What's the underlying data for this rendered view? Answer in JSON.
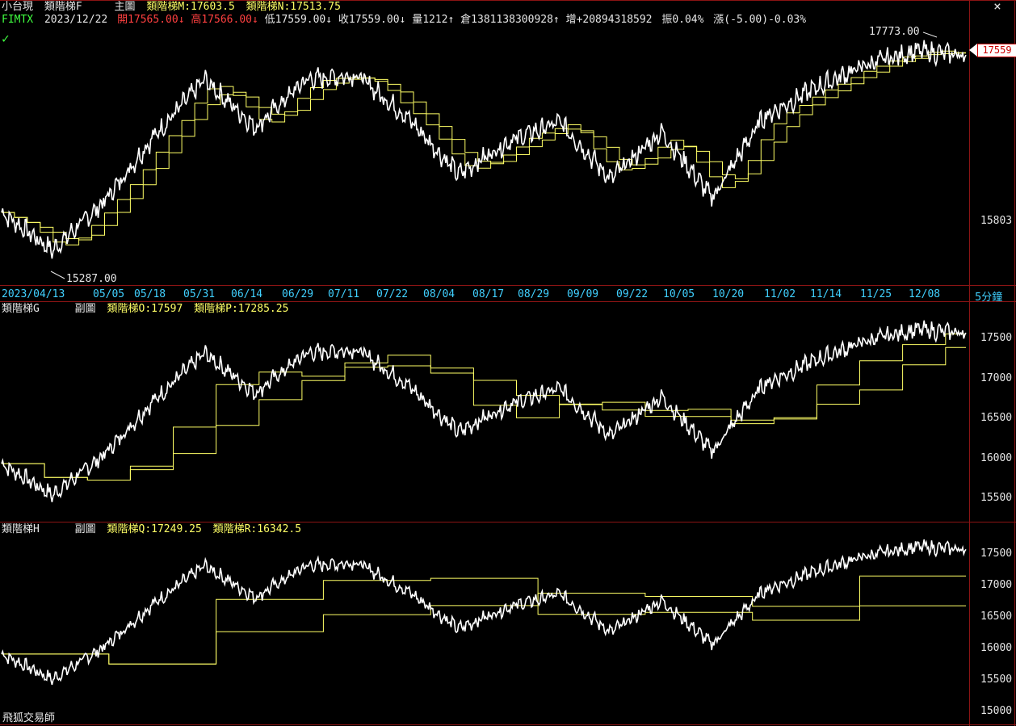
{
  "header": {
    "symbol": "小台現",
    "indicator": "類階梯F",
    "main_label": "主圖",
    "m_label": "類階梯M:",
    "m_value": "17603.5",
    "n_label": "類階梯N:",
    "n_value": "17513.75",
    "code": "FIMTX",
    "date": "2023/12/22",
    "open": "開17565.00↓",
    "high": "高17566.00↓",
    "low": "低17559.00↓",
    "close": "收17559.00↓",
    "volume": "量1212↑",
    "oi": "倉1381138300928↑",
    "incr": "增+20894318592",
    "amp": "振0.04%",
    "chg": "漲(-5.00)-0.03%"
  },
  "close_icon": "×",
  "check_icon": "✓",
  "price_tag": "17559",
  "main_chart": {
    "high_mark": "17773.00",
    "low_mark": "15287.00",
    "right_label": "15803",
    "interval": "5分鐘",
    "dates": [
      "2023/04/13",
      "05/05",
      "05/18",
      "05/31",
      "06/14",
      "06/29",
      "07/11",
      "07/22",
      "08/04",
      "08/17",
      "08/29",
      "09/09",
      "09/22",
      "10/05",
      "10/20",
      "11/02",
      "11/14",
      "11/25",
      "12/08"
    ]
  },
  "sub1": {
    "indicator": "類階梯G",
    "label": "副圖",
    "o_label": "類階梯O:",
    "o_value": "17597",
    "p_label": "類階梯P:",
    "p_value": "17285.25",
    "ticks": [
      "17500",
      "17000",
      "16500",
      "16000",
      "15500"
    ]
  },
  "sub2": {
    "indicator": "類階梯H",
    "label": "副圖",
    "q_label": "類階梯Q:",
    "q_value": "17249.25",
    "r_label": "類階梯R:",
    "r_value": "16342.5",
    "ticks": [
      "17500",
      "17000",
      "16500",
      "16000",
      "15500",
      "15000"
    ]
  },
  "watermark": "飛狐交易師",
  "colors": {
    "price": "#ffffff",
    "step": "#ffff66",
    "frame": "#8b1414",
    "date": "#40d0ff",
    "up": "#ff4040",
    "highlight": "#ff00ff"
  },
  "chart_data": {
    "type": "line",
    "x": [
      "2023/04/13",
      "05/05",
      "05/18",
      "05/31",
      "06/14",
      "06/29",
      "07/11",
      "07/22",
      "08/04",
      "08/17",
      "08/29",
      "09/09",
      "09/22",
      "10/05",
      "10/20",
      "11/02",
      "11/14",
      "11/25",
      "12/08",
      "12/22"
    ],
    "series": [
      {
        "name": "price",
        "values": [
          15900,
          15500,
          16000,
          16700,
          17300,
          16800,
          17300,
          17350,
          16900,
          16300,
          16650,
          16850,
          16250,
          16750,
          16050,
          16900,
          17200,
          17450,
          17600,
          17559
        ]
      }
    ]
  }
}
